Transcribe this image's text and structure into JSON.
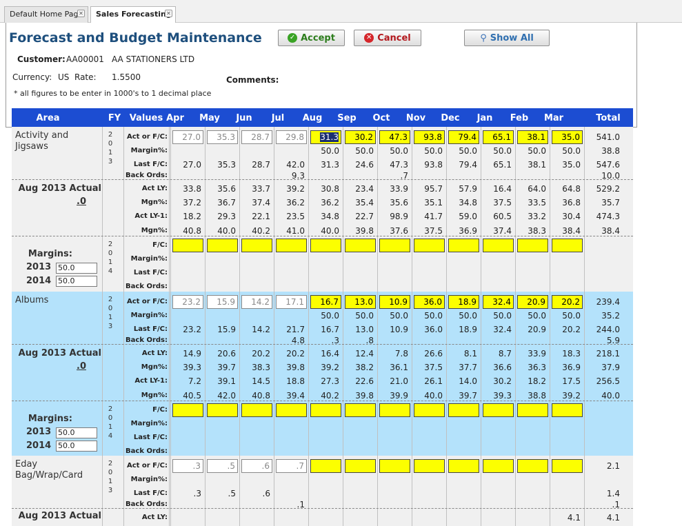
{
  "tabs": [
    {
      "label": "Default Home Page",
      "active": false
    },
    {
      "label": "Sales Forecasting",
      "active": true
    }
  ],
  "header": {
    "title": "Forecast and Budget Maintenance",
    "accept": "Accept",
    "cancel": "Cancel",
    "show_all": "Show All"
  },
  "info": {
    "customer_label": "Customer:",
    "customer_code": "AA00001",
    "customer_name": "AA STATIONERS LTD",
    "currency_label": "Currency:",
    "currency": "US",
    "rate_label": "Rate:",
    "rate": "1.5500",
    "note": "* all figures to be enter in 1000's to 1 decimal place",
    "comments_label": "Comments:"
  },
  "columns": {
    "area": "Area",
    "fy": "FY",
    "values": "Values",
    "months": [
      "Apr",
      "May",
      "Jun",
      "Jul",
      "Aug",
      "Sep",
      "Oct",
      "Nov",
      "Dec",
      "Jan",
      "Feb",
      "Mar"
    ],
    "total": "Total"
  },
  "labels": {
    "act_fc": "Act or F/C:",
    "margin": "Margin%:",
    "last_fc": "Last F/C:",
    "back_ords": "Back Ords:",
    "act_ly": "Act LY:",
    "mgn": "Mgn%:",
    "act_ly1": "Act LY-1:",
    "fc": "F/C:",
    "margins": "Margins:"
  },
  "areas": [
    {
      "name": "Activity and Jigsaws",
      "fy1": [
        "2",
        "0",
        "1",
        "3"
      ],
      "fy2": [
        "2",
        "0",
        "1",
        "4"
      ],
      "actual_label": "Aug 2013 Actual",
      "actual_value": ".0",
      "margin_2013": "50.0",
      "margin_2014": "50.0",
      "year1": "2013",
      "year2": "2014",
      "act_fc": [
        "27.0",
        "35.3",
        "28.7",
        "29.8",
        "31.3",
        "30.2",
        "47.3",
        "93.8",
        "79.4",
        "65.1",
        "38.1",
        "35.0",
        "541.0"
      ],
      "margin": [
        "",
        "",
        "",
        "",
        "50.0",
        "50.0",
        "50.0",
        "50.0",
        "50.0",
        "50.0",
        "50.0",
        "50.0",
        "38.8"
      ],
      "last_fc": [
        "27.0",
        "35.3",
        "28.7",
        "42.0",
        "31.3",
        "24.6",
        "47.3",
        "93.8",
        "79.4",
        "65.1",
        "38.1",
        "35.0",
        "547.6"
      ],
      "back_ords": [
        "",
        "",
        "",
        "9.3",
        "",
        "",
        ".7",
        "",
        "",
        "",
        "",
        "",
        "10.0"
      ],
      "act_ly": [
        "33.8",
        "35.6",
        "33.7",
        "39.2",
        "30.8",
        "23.4",
        "33.9",
        "95.7",
        "57.9",
        "16.4",
        "64.0",
        "64.8",
        "529.2"
      ],
      "mgn": [
        "37.2",
        "36.7",
        "37.4",
        "36.2",
        "36.2",
        "35.4",
        "35.6",
        "35.1",
        "34.8",
        "37.5",
        "33.5",
        "36.8",
        "35.7"
      ],
      "act_ly1": [
        "18.2",
        "29.3",
        "22.1",
        "23.5",
        "34.8",
        "22.7",
        "98.9",
        "41.7",
        "59.0",
        "60.5",
        "33.2",
        "30.4",
        "474.3"
      ],
      "mgn1": [
        "40.8",
        "40.0",
        "40.2",
        "41.0",
        "40.0",
        "39.8",
        "37.6",
        "37.5",
        "36.9",
        "37.4",
        "38.3",
        "38.4",
        "38.4"
      ]
    },
    {
      "name": "Albums",
      "fy1": [
        "2",
        "0",
        "1",
        "3"
      ],
      "fy2": [
        "2",
        "0",
        "1",
        "4"
      ],
      "actual_label": "Aug 2013 Actual",
      "actual_value": ".0",
      "margin_2013": "50.0",
      "margin_2014": "50.0",
      "year1": "2013",
      "year2": "2014",
      "act_fc": [
        "23.2",
        "15.9",
        "14.2",
        "17.1",
        "16.7",
        "13.0",
        "10.9",
        "36.0",
        "18.9",
        "32.4",
        "20.9",
        "20.2",
        "239.4"
      ],
      "margin": [
        "",
        "",
        "",
        "",
        "50.0",
        "50.0",
        "50.0",
        "50.0",
        "50.0",
        "50.0",
        "50.0",
        "50.0",
        "35.2"
      ],
      "last_fc": [
        "23.2",
        "15.9",
        "14.2",
        "21.7",
        "16.7",
        "13.0",
        "10.9",
        "36.0",
        "18.9",
        "32.4",
        "20.9",
        "20.2",
        "244.0"
      ],
      "back_ords": [
        "",
        "",
        "",
        "4.8",
        ".3",
        ".8",
        "",
        "",
        "",
        "",
        "",
        "",
        "5.9"
      ],
      "act_ly": [
        "14.9",
        "20.6",
        "20.2",
        "20.2",
        "16.4",
        "12.4",
        "7.8",
        "26.6",
        "8.1",
        "8.7",
        "33.9",
        "18.3",
        "218.1"
      ],
      "mgn": [
        "39.3",
        "39.7",
        "38.3",
        "39.8",
        "39.2",
        "38.2",
        "36.1",
        "37.5",
        "37.7",
        "36.6",
        "36.3",
        "36.9",
        "37.9"
      ],
      "act_ly1": [
        "7.2",
        "39.1",
        "14.5",
        "18.8",
        "27.3",
        "22.6",
        "21.0",
        "26.1",
        "14.0",
        "30.2",
        "18.2",
        "17.5",
        "256.5"
      ],
      "mgn1": [
        "40.5",
        "42.0",
        "40.8",
        "39.4",
        "40.2",
        "39.8",
        "39.9",
        "40.0",
        "39.7",
        "39.3",
        "38.8",
        "39.2",
        "40.0"
      ]
    },
    {
      "name": "Eday Bag/Wrap/Card",
      "fy1": [
        "2",
        "0",
        "1",
        "3"
      ],
      "actual_label": "Aug 2013 Actual",
      "act_fc": [
        ".3",
        ".5",
        ".6",
        ".7",
        "",
        "",
        "",
        "",
        "",
        "",
        "",
        "",
        "2.1"
      ],
      "margin": [
        "",
        "",
        "",
        "",
        "",
        "",
        "",
        "",
        "",
        "",
        "",
        "",
        ""
      ],
      "last_fc": [
        ".3",
        ".5",
        ".6",
        "",
        "",
        "",
        "",
        "",
        "",
        "",
        "",
        "",
        "1.4"
      ],
      "back_ords": [
        "",
        "",
        "",
        ".1",
        "",
        "",
        "",
        "",
        "",
        "",
        "",
        "",
        ".1"
      ],
      "act_ly": [
        "",
        "",
        "",
        "",
        "",
        "",
        "",
        "",
        "",
        "",
        "",
        "4.1",
        "4.1"
      ]
    }
  ]
}
